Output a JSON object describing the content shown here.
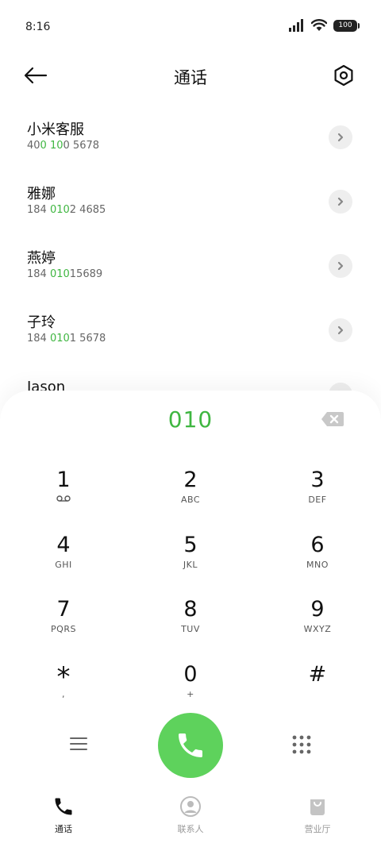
{
  "status_bar": {
    "time": "8:16",
    "battery": "100"
  },
  "header": {
    "title": "通话"
  },
  "contacts": [
    {
      "name": "小米客服",
      "number_parts": [
        "40",
        "0",
        " ",
        "10",
        "0 5678"
      ]
    },
    {
      "name": "雅娜",
      "number_parts": [
        "184 ",
        "010",
        "2 4685",
        "",
        ""
      ]
    },
    {
      "name": "燕婷",
      "number_parts": [
        "184 ",
        "010",
        "15689",
        "",
        ""
      ]
    },
    {
      "name": "子玲",
      "number_parts": [
        "184 ",
        "010",
        "1 5678",
        "",
        ""
      ]
    },
    {
      "name": "Jason",
      "number_parts": [
        "",
        "",
        "",
        "",
        ""
      ]
    }
  ],
  "dialer": {
    "input": "010",
    "keys": [
      [
        {
          "digit": "1",
          "letters": ""
        },
        {
          "digit": "2",
          "letters": "ABC"
        },
        {
          "digit": "3",
          "letters": "DEF"
        }
      ],
      [
        {
          "digit": "4",
          "letters": "GHI"
        },
        {
          "digit": "5",
          "letters": "JKL"
        },
        {
          "digit": "6",
          "letters": "MNO"
        }
      ],
      [
        {
          "digit": "7",
          "letters": "PQRS"
        },
        {
          "digit": "8",
          "letters": "TUV"
        },
        {
          "digit": "9",
          "letters": "WXYZ"
        }
      ],
      [
        {
          "digit": "*",
          "letters": ","
        },
        {
          "digit": "0",
          "letters": "+"
        },
        {
          "digit": "#",
          "letters": ""
        }
      ]
    ]
  },
  "bottom_nav": {
    "calls": "通话",
    "contacts": "联系人",
    "store": "营业厅"
  },
  "colors": {
    "accent": "#3fb641",
    "call_button": "#5ed25c"
  }
}
